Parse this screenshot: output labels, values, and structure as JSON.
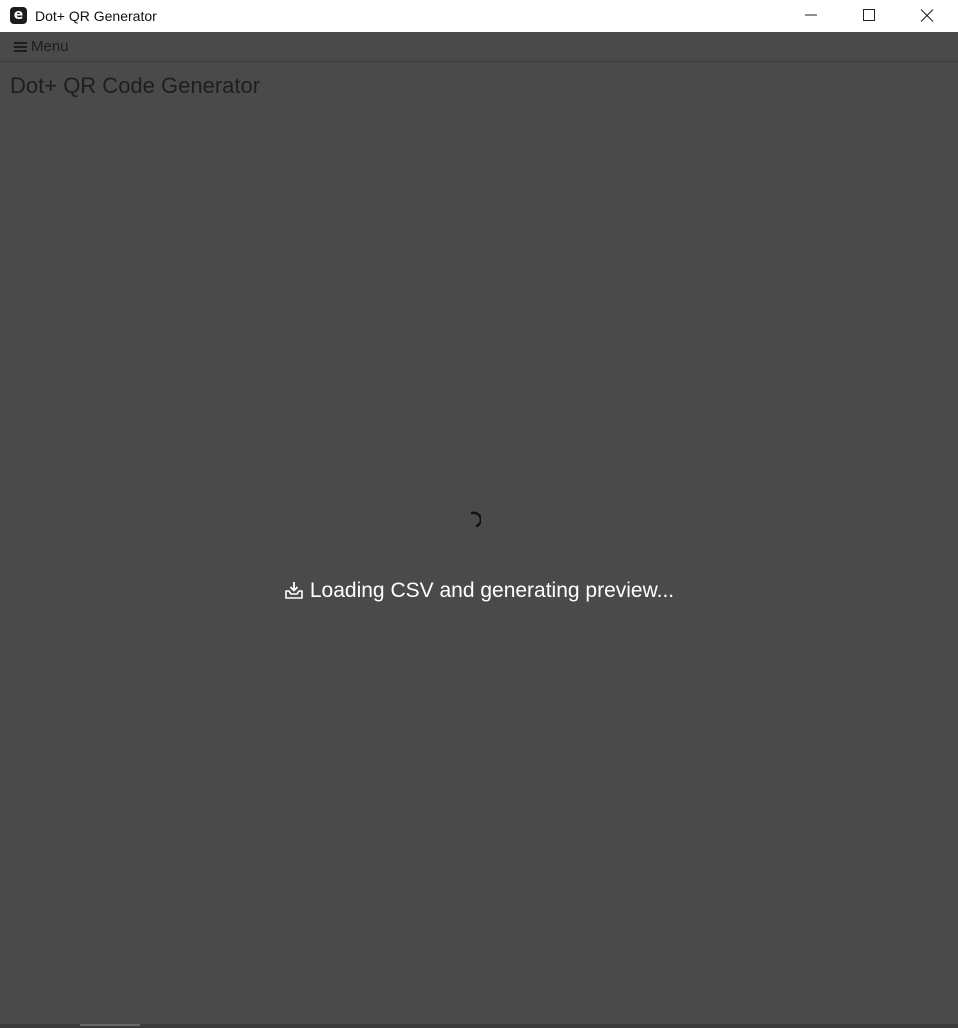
{
  "window": {
    "title": "Dot+ QR Generator",
    "icon": "app-e-icon",
    "icon_glyph": "e",
    "controls": [
      "minimize-icon",
      "maximize-icon",
      "close-icon"
    ]
  },
  "menu": {
    "label": "Menu",
    "icon": "hamburger-icon"
  },
  "main": {
    "heading": "Dot+ QR Code Generator",
    "loading": {
      "icon": "inbox-tray-icon",
      "text": "Loading CSV and generating preview...",
      "spinner": "spinner-icon"
    }
  },
  "colors": {
    "background": "#4a4a4a",
    "titlebar": "#ffffff",
    "heading_text": "#1e1e1e",
    "loading_text": "#ffffff"
  }
}
